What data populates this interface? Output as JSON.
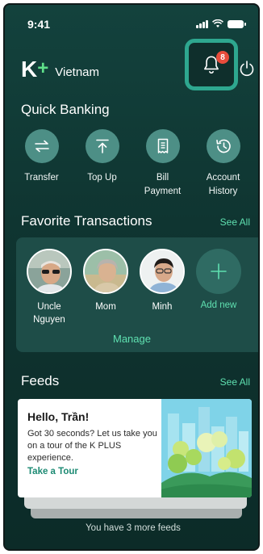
{
  "status_bar": {
    "time": "9:41"
  },
  "header": {
    "brand_letter": "K",
    "brand_plus": "+",
    "country": "Vietnam",
    "notification_count": "8"
  },
  "quick_banking": {
    "title": "Quick Banking",
    "items": [
      {
        "label": "Transfer",
        "icon": "transfer-icon"
      },
      {
        "label": "Top Up",
        "icon": "top-up-icon"
      },
      {
        "label": "Bill\nPayment",
        "icon": "bill-icon"
      },
      {
        "label": "Account\nHistory",
        "icon": "history-icon"
      }
    ]
  },
  "favorites": {
    "title": "Favorite Transactions",
    "see_all": "See All",
    "contacts": [
      {
        "name": "Uncle\nNguyen"
      },
      {
        "name": "Mom"
      },
      {
        "name": "Minh"
      }
    ],
    "add_label": "Add new",
    "manage": "Manage"
  },
  "feeds": {
    "title": "Feeds",
    "see_all": "See All",
    "card": {
      "title": "Hello, Trần!",
      "body": "Got 30 seconds? Let us take you on a tour of the K PLUS experience.",
      "link": "Take a Tour"
    },
    "more": "You have 3 more feeds"
  },
  "colors": {
    "accent": "#5fe0b0",
    "brand_green": "#5fe08a",
    "highlight": "#2ea78f",
    "badge": "#e74c3c"
  }
}
